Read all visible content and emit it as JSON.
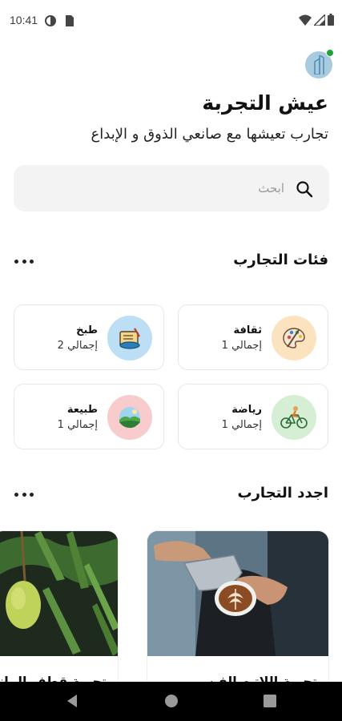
{
  "status_bar": {
    "time": "10:41",
    "icons": [
      "sync-icon",
      "sim-card-icon",
      "wifi-icon",
      "signal-icon",
      "battery-icon"
    ]
  },
  "profile": {
    "avatar_icon": "building-icon",
    "status": "online",
    "status_color": "#20a23b"
  },
  "header": {
    "title": "عيش التجربة",
    "subtitle": "تجارب تعيشها مع صانعي الذوق و الإبداع"
  },
  "search": {
    "placeholder": "ابحث",
    "value": ""
  },
  "categories_section": {
    "title": "فئات التجارب",
    "items": [
      {
        "name": "ثقافة",
        "count": "إجمالي 1",
        "icon": "palette-icon",
        "color": "#fce3c0"
      },
      {
        "name": "طبخ",
        "count": "إجمالي 2",
        "icon": "cooking-icon",
        "color": "#bcdff5"
      },
      {
        "name": "رياضة",
        "count": "إجمالي 1",
        "icon": "cyclist-icon",
        "color": "#d6efd4"
      },
      {
        "name": "طبيعة",
        "count": "إجمالي 1",
        "icon": "landscape-icon",
        "color": "#f8cccc"
      }
    ]
  },
  "latest_section": {
    "title": "اجدد التجارب",
    "items": [
      {
        "title": "تجربة اللاتيه الفن",
        "image": "latte-art-photo"
      },
      {
        "title": "تجربة قطف المانجو",
        "image": "mango-tree-photo"
      }
    ]
  },
  "nav_bar": {
    "back": "back-icon",
    "home": "home-icon",
    "recents": "recents-icon"
  },
  "colors": {
    "accent_green": "#20a23b",
    "search_bg": "#f3f3f3",
    "card_border": "#e8e8e8"
  }
}
